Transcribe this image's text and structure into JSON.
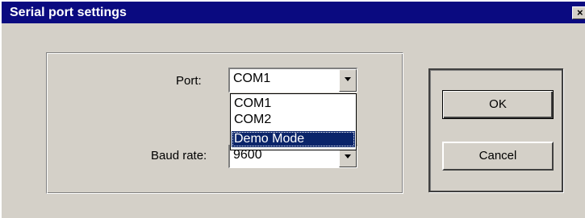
{
  "window": {
    "title": "Serial port settings",
    "close_glyph": "×",
    "title_bar_color": "#0a0a80",
    "face_color": "#d4d0c8"
  },
  "form": {
    "port_label": "Port:",
    "port_value": "COM1",
    "port_options": [
      "COM1",
      "COM2",
      "Demo Mode"
    ],
    "port_highlighted": "Demo Mode",
    "baud_label": "Baud rate:",
    "baud_value": "9600"
  },
  "buttons": {
    "ok_label": "OK",
    "cancel_label": "Cancel"
  },
  "icons": {
    "dropdown_arrow": "chevron-down-icon",
    "close": "close-icon"
  }
}
